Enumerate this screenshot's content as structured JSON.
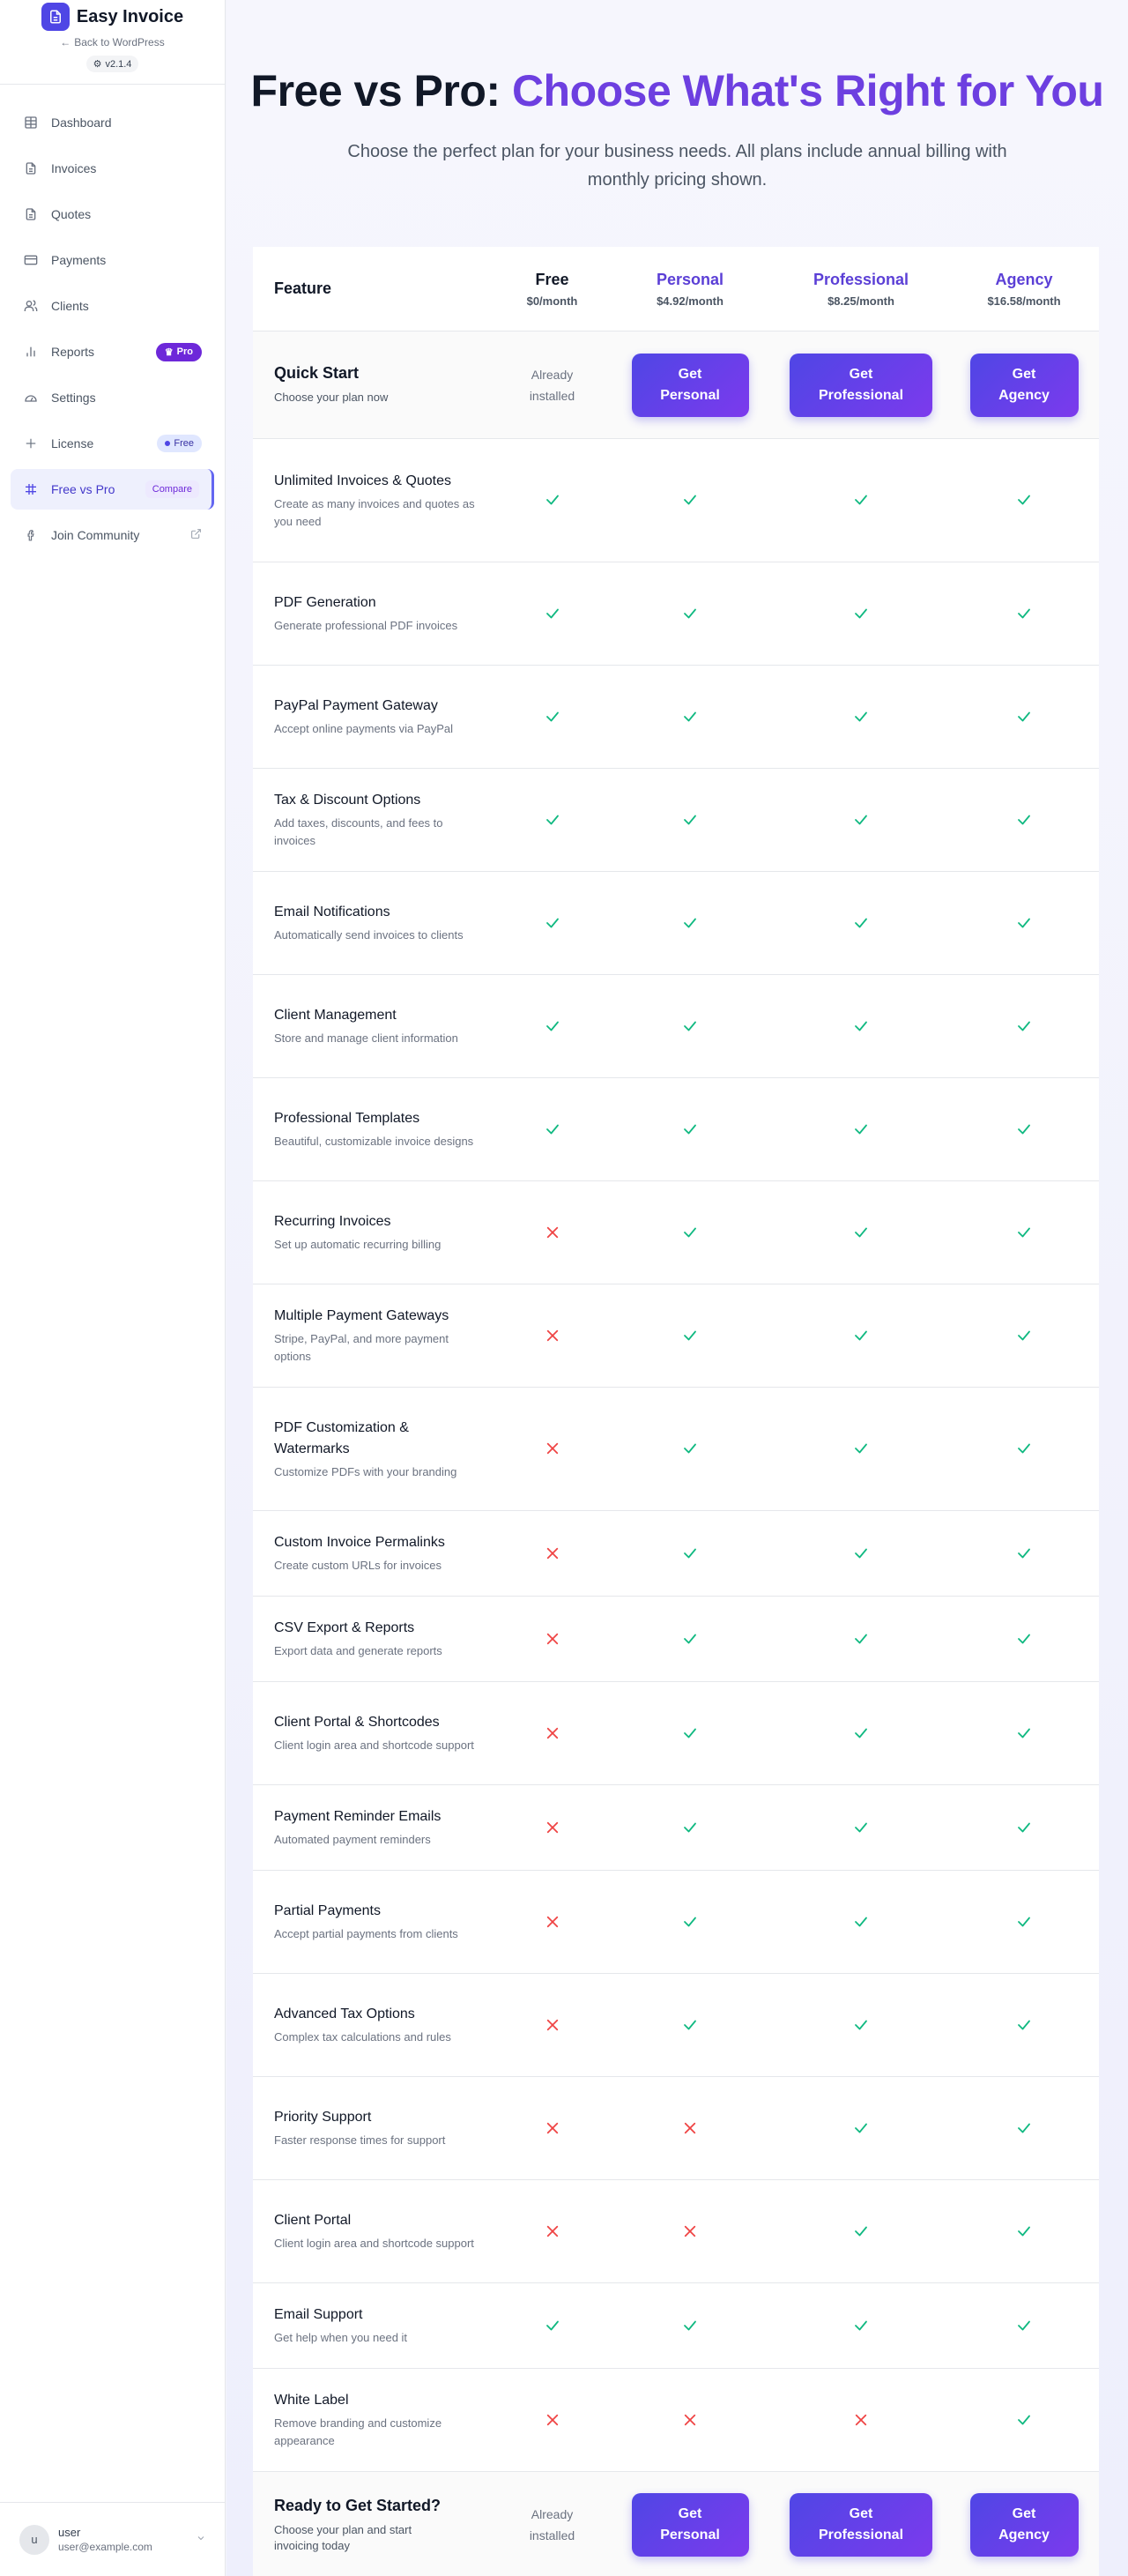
{
  "sidebar": {
    "brand": "Easy Invoice",
    "back_link": "Back to WordPress",
    "version": "v2.1.4",
    "nav": [
      {
        "key": "dashboard",
        "label": "Dashboard",
        "icon": "grid-icon",
        "badge": ""
      },
      {
        "key": "invoices",
        "label": "Invoices",
        "icon": "document-icon",
        "badge": ""
      },
      {
        "key": "quotes",
        "label": "Quotes",
        "icon": "document-icon",
        "badge": ""
      },
      {
        "key": "payments",
        "label": "Payments",
        "icon": "credit-card-icon",
        "badge": ""
      },
      {
        "key": "clients",
        "label": "Clients",
        "icon": "users-icon",
        "badge": ""
      },
      {
        "key": "reports",
        "label": "Reports",
        "icon": "bar-chart-icon",
        "badge": "Pro"
      },
      {
        "key": "settings",
        "label": "Settings",
        "icon": "gauge-icon",
        "badge": ""
      },
      {
        "key": "license",
        "label": "License",
        "icon": "plus-icon",
        "badge": "Free"
      },
      {
        "key": "free-vs-pro",
        "label": "Free vs Pro",
        "icon": "table-icon",
        "badge": "Compare"
      },
      {
        "key": "join-community",
        "label": "Join Community",
        "icon": "facebook-icon",
        "badge": ""
      }
    ],
    "active": "free-vs-pro",
    "user": {
      "initial": "u",
      "name": "user",
      "email": "user@example.com"
    }
  },
  "hero": {
    "title_plain": "Free vs Pro: ",
    "title_accent": "Choose What's Right for You",
    "subtitle": "Choose the perfect plan for your business needs. All plans include annual billing with monthly pricing shown."
  },
  "table": {
    "feature_header": "Feature",
    "plans": [
      {
        "name": "Free",
        "price": "$0/month"
      },
      {
        "name": "Personal",
        "price": "$4.92/month"
      },
      {
        "name": "Professional",
        "price": "$8.25/month"
      },
      {
        "name": "Agency",
        "price": "$16.58/month"
      }
    ],
    "quick_start": {
      "title": "Quick Start",
      "desc": "Choose your plan now"
    },
    "already_installed": "Already installed",
    "buttons": [
      "Get Personal",
      "Get Professional",
      "Get Agency"
    ],
    "features": [
      {
        "title": "Unlimited Invoices & Quotes",
        "desc": "Create as many invoices and quotes as you need",
        "avail": [
          true,
          true,
          true,
          true
        ]
      },
      {
        "title": "PDF Generation",
        "desc": "Generate professional PDF invoices",
        "avail": [
          true,
          true,
          true,
          true
        ]
      },
      {
        "title": "PayPal Payment Gateway",
        "desc": "Accept online payments via PayPal",
        "avail": [
          true,
          true,
          true,
          true
        ]
      },
      {
        "title": "Tax & Discount Options",
        "desc": "Add taxes, discounts, and fees to invoices",
        "avail": [
          true,
          true,
          true,
          true
        ]
      },
      {
        "title": "Email Notifications",
        "desc": "Automatically send invoices to clients",
        "avail": [
          true,
          true,
          true,
          true
        ]
      },
      {
        "title": "Client Management",
        "desc": "Store and manage client information",
        "avail": [
          true,
          true,
          true,
          true
        ]
      },
      {
        "title": "Professional Templates",
        "desc": "Beautiful, customizable invoice designs",
        "avail": [
          true,
          true,
          true,
          true
        ]
      },
      {
        "title": "Recurring Invoices",
        "desc": "Set up automatic recurring billing",
        "avail": [
          false,
          true,
          true,
          true
        ]
      },
      {
        "title": "Multiple Payment Gateways",
        "desc": "Stripe, PayPal, and more payment options",
        "avail": [
          false,
          true,
          true,
          true
        ]
      },
      {
        "title": "PDF Customization & Watermarks",
        "desc": "Customize PDFs with your branding",
        "avail": [
          false,
          true,
          true,
          true
        ]
      },
      {
        "title": "Custom Invoice Permalinks",
        "desc": "Create custom URLs for invoices",
        "avail": [
          false,
          true,
          true,
          true
        ]
      },
      {
        "title": "CSV Export & Reports",
        "desc": "Export data and generate reports",
        "avail": [
          false,
          true,
          true,
          true
        ]
      },
      {
        "title": "Client Portal & Shortcodes",
        "desc": "Client login area and shortcode support",
        "avail": [
          false,
          true,
          true,
          true
        ]
      },
      {
        "title": "Payment Reminder Emails",
        "desc": "Automated payment reminders",
        "avail": [
          false,
          true,
          true,
          true
        ]
      },
      {
        "title": "Partial Payments",
        "desc": "Accept partial payments from clients",
        "avail": [
          false,
          true,
          true,
          true
        ]
      },
      {
        "title": "Advanced Tax Options",
        "desc": "Complex tax calculations and rules",
        "avail": [
          false,
          true,
          true,
          true
        ]
      },
      {
        "title": "Priority Support",
        "desc": "Faster response times for support",
        "avail": [
          false,
          false,
          true,
          true
        ]
      },
      {
        "title": "Client Portal",
        "desc": "Client login area and shortcode support",
        "avail": [
          false,
          false,
          true,
          true
        ]
      },
      {
        "title": "Email Support",
        "desc": "Get help when you need it",
        "avail": [
          true,
          true,
          true,
          true
        ]
      },
      {
        "title": "White Label",
        "desc": "Remove branding and customize appearance",
        "avail": [
          false,
          false,
          false,
          true
        ]
      }
    ],
    "footer": {
      "title": "Ready to Get Started?",
      "desc": "Choose your plan and start invoicing today"
    }
  },
  "colors": {
    "accent": "#6d3fe0",
    "check": "#10b981",
    "cross": "#ef4444",
    "button_start": "#4f46e5",
    "button_end": "#7c3aed"
  }
}
